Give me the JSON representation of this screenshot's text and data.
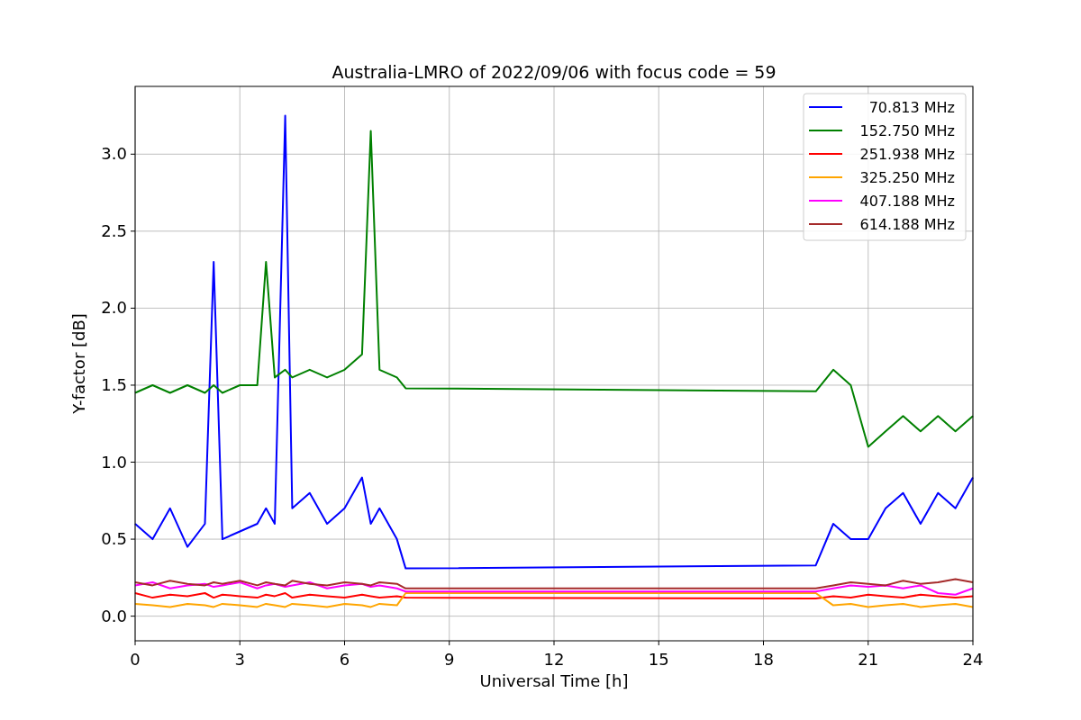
{
  "plot": {
    "chart_data": {
      "type": "line",
      "title": "Australia-LMRO of 2022/09/06 with focus code = 59",
      "xlabel": "Universal Time [h]",
      "ylabel": "Y-factor [dB]",
      "x": [
        0,
        0.5,
        1,
        1.5,
        2,
        2.25,
        2.5,
        3,
        3.5,
        3.75,
        4,
        4.3,
        4.5,
        5,
        5.5,
        6,
        6.5,
        6.75,
        7,
        7.5,
        7.75,
        19.5,
        20,
        20.5,
        21,
        21.5,
        22,
        22.5,
        23,
        23.5,
        24
      ],
      "series": [
        {
          "name": "70.813 MHz",
          "color": "#0000ff",
          "values": [
            0.6,
            0.5,
            0.7,
            0.45,
            0.6,
            2.3,
            0.5,
            0.55,
            0.6,
            0.7,
            0.6,
            3.25,
            0.7,
            0.8,
            0.6,
            0.7,
            0.9,
            0.6,
            0.7,
            0.5,
            0.31,
            0.33,
            0.6,
            0.5,
            0.5,
            0.7,
            0.8,
            0.6,
            0.8,
            0.7,
            0.9
          ]
        },
        {
          "name": "152.750 MHz",
          "color": "#008000",
          "values": [
            1.45,
            1.5,
            1.45,
            1.5,
            1.45,
            1.5,
            1.45,
            1.5,
            1.5,
            2.3,
            1.55,
            1.6,
            1.55,
            1.6,
            1.55,
            1.6,
            1.7,
            3.15,
            1.6,
            1.55,
            1.48,
            1.46,
            1.6,
            1.5,
            1.1,
            1.2,
            1.3,
            1.2,
            1.3,
            1.2,
            1.3
          ]
        },
        {
          "name": "251.938 MHz",
          "color": "#ff0000",
          "values": [
            0.15,
            0.12,
            0.14,
            0.13,
            0.15,
            0.12,
            0.14,
            0.13,
            0.12,
            0.14,
            0.13,
            0.15,
            0.12,
            0.14,
            0.13,
            0.12,
            0.14,
            0.13,
            0.12,
            0.13,
            0.12,
            0.115,
            0.13,
            0.12,
            0.14,
            0.13,
            0.12,
            0.14,
            0.13,
            0.12,
            0.13
          ]
        },
        {
          "name": "325.250 MHz",
          "color": "#ffa500",
          "values": [
            0.08,
            0.07,
            0.06,
            0.08,
            0.07,
            0.06,
            0.08,
            0.07,
            0.06,
            0.08,
            0.07,
            0.06,
            0.08,
            0.07,
            0.06,
            0.08,
            0.07,
            0.06,
            0.08,
            0.07,
            0.15,
            0.15,
            0.07,
            0.08,
            0.06,
            0.07,
            0.08,
            0.06,
            0.07,
            0.08,
            0.06
          ]
        },
        {
          "name": "407.188 MHz",
          "color": "#ff00ff",
          "values": [
            0.2,
            0.22,
            0.18,
            0.2,
            0.21,
            0.19,
            0.2,
            0.22,
            0.18,
            0.2,
            0.21,
            0.19,
            0.2,
            0.22,
            0.18,
            0.2,
            0.21,
            0.19,
            0.2,
            0.18,
            0.16,
            0.16,
            0.18,
            0.2,
            0.19,
            0.2,
            0.18,
            0.2,
            0.15,
            0.14,
            0.18
          ]
        },
        {
          "name": "614.188 MHz",
          "color": "#a52a2a",
          "values": [
            0.22,
            0.2,
            0.23,
            0.21,
            0.2,
            0.22,
            0.21,
            0.23,
            0.2,
            0.22,
            0.21,
            0.2,
            0.23,
            0.21,
            0.2,
            0.22,
            0.21,
            0.2,
            0.22,
            0.21,
            0.18,
            0.18,
            0.2,
            0.22,
            0.21,
            0.2,
            0.23,
            0.21,
            0.22,
            0.24,
            0.22
          ]
        }
      ],
      "grid": true,
      "legend": true,
      "xlim": [
        0,
        24
      ],
      "ylim": [
        -0.16,
        3.44
      ],
      "xticks": [
        0,
        3,
        6,
        9,
        12,
        15,
        18,
        21,
        24
      ],
      "yticks": [
        {
          "value": 0,
          "label": "0.0"
        },
        {
          "value": 0.5,
          "label": "0.5"
        },
        {
          "value": 1,
          "label": "1.0"
        },
        {
          "value": 1.5,
          "label": "1.5"
        },
        {
          "value": 2,
          "label": "2.0"
        },
        {
          "value": 2.5,
          "label": "2.5"
        },
        {
          "value": 3,
          "label": "3.0"
        }
      ]
    }
  }
}
